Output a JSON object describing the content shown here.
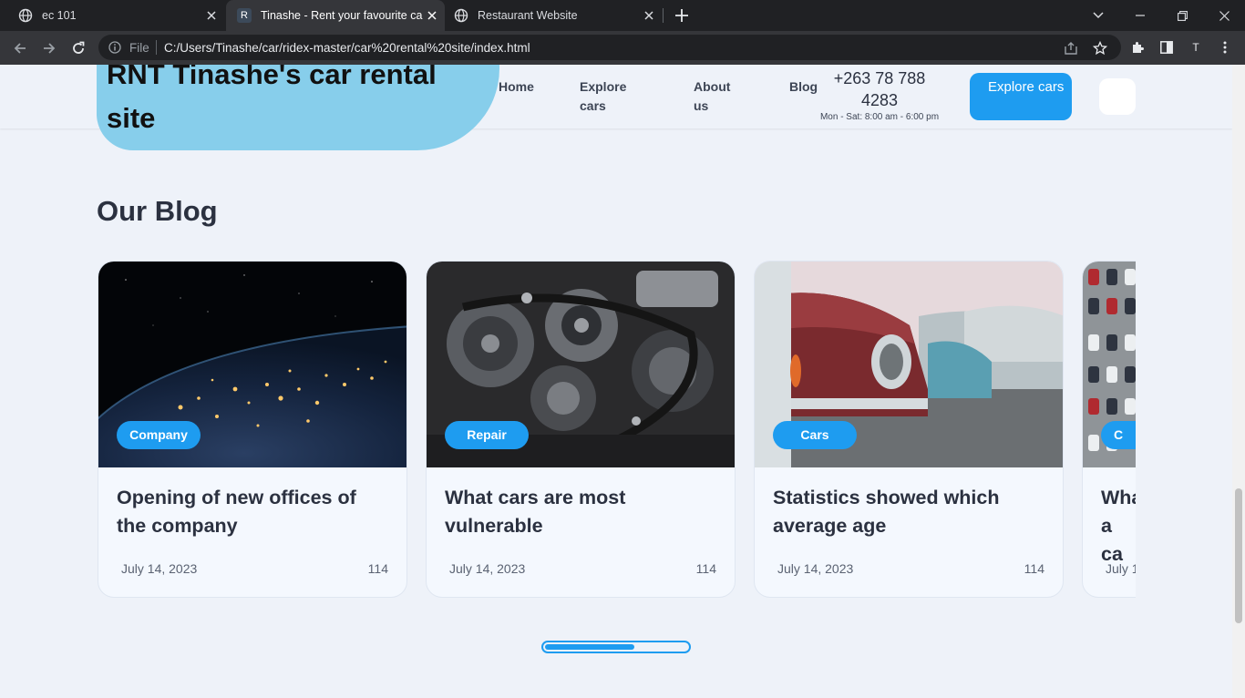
{
  "browser": {
    "tabs": [
      {
        "title": "ec 101",
        "favicon": "globe-icon",
        "active": false
      },
      {
        "title": "Tinashe - Rent your favourite car",
        "favicon": "R",
        "active": true
      },
      {
        "title": "Restaurant Website",
        "favicon": "globe-icon",
        "active": false
      }
    ],
    "omnibox": {
      "scheme_label": "File",
      "url": "C:/Users/Tinashe/car/ridex-master/car%20rental%20site/index.html"
    },
    "profile_initial": "T"
  },
  "header": {
    "logo": "RNT Tinashe's car rental site",
    "nav": [
      "Home",
      "Explore cars",
      "About us",
      "Blog"
    ],
    "phone": "+263 78 788 4283",
    "hours": "Mon - Sat: 8:00 am - 6:00 pm",
    "cta": "Explore cars"
  },
  "blog": {
    "title": "Our Blog",
    "posts": [
      {
        "tag": "Company",
        "title": "Opening of new offices of the company",
        "date": "July 14, 2023",
        "count": "114",
        "image": "earth-at-night"
      },
      {
        "tag": "Repair",
        "title": "What cars are most vulnerable",
        "date": "July 14, 2023",
        "count": "114",
        "image": "car-engine"
      },
      {
        "tag": "Cars",
        "title": "Statistics showed which average age",
        "date": "July 14, 2023",
        "count": "114",
        "image": "vintage-cars"
      },
      {
        "tag": "C",
        "title": "Wha a ca",
        "date": "July 1",
        "count": "",
        "image": "parking-lot"
      }
    ]
  },
  "slider": {
    "progress": 0.63
  },
  "colors": {
    "accent": "#1e9cf0",
    "logo_bg": "#87ceeb",
    "page_bg": "#eef2f9",
    "chrome_dark": "#202124",
    "chrome_mid": "#35363a"
  }
}
